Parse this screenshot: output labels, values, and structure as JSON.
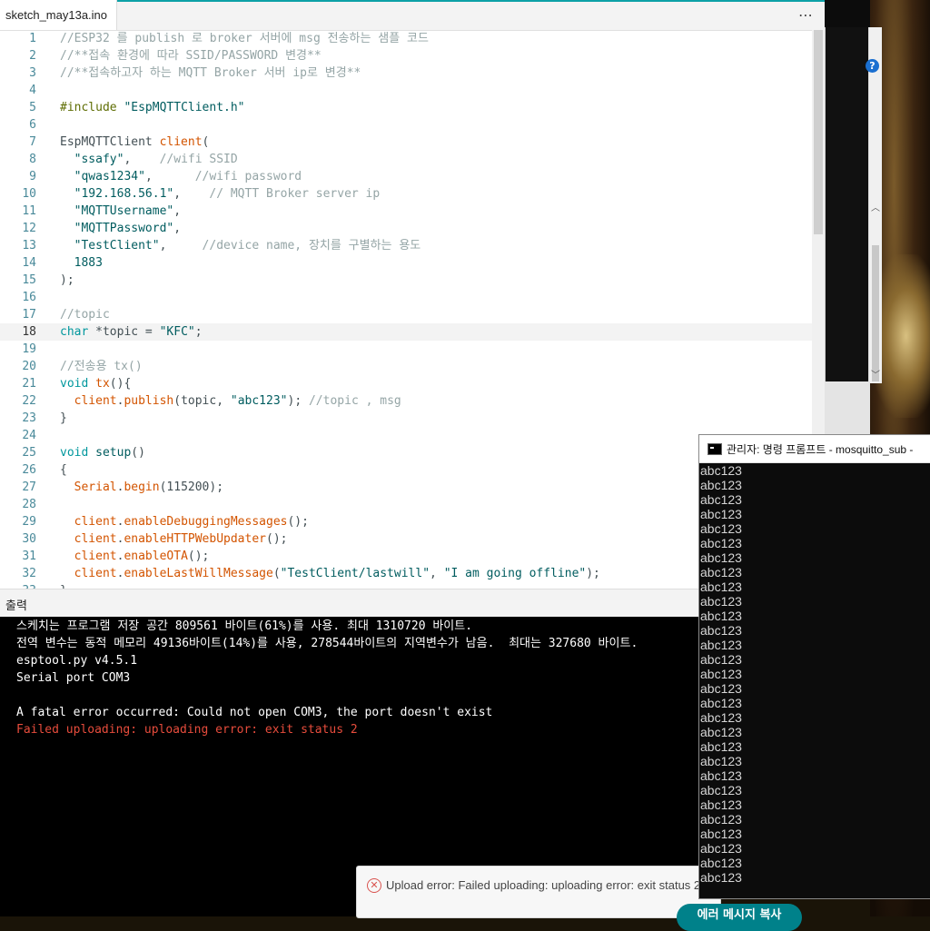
{
  "editor": {
    "tab_name": "sketch_may13a.ino",
    "more_menu": "⋯",
    "lines": [
      {
        "n": "1",
        "html": "<span class='c'>//ESP32 를 publish 로 broker 서버에 msg 전송하는 샘플 코드</span>"
      },
      {
        "n": "2",
        "html": "<span class='c'>//**접속 환경에 따라 SSID/PASSWORD 변경**</span>"
      },
      {
        "n": "3",
        "html": "<span class='c'>//**접속하고자 하는 MQTT Broker 서버 ip로 변경**</span>"
      },
      {
        "n": "4",
        "html": ""
      },
      {
        "n": "5",
        "html": "<span class='p'>#include</span> <span class='s'>\"EspMQTTClient.h\"</span>"
      },
      {
        "n": "6",
        "html": ""
      },
      {
        "n": "7",
        "html": "EspMQTTClient <span class='f'>client</span>("
      },
      {
        "n": "8",
        "html": "  <span class='s'>\"ssafy\"</span>,    <span class='c'>//wifi SSID</span>"
      },
      {
        "n": "9",
        "html": "  <span class='s'>\"qwas1234\"</span>,      <span class='c'>//wifi password</span>"
      },
      {
        "n": "10",
        "html": "  <span class='s'>\"192.168.56.1\"</span>,    <span class='c'>// MQTT Broker server ip</span>"
      },
      {
        "n": "11",
        "html": "  <span class='s'>\"MQTTUsername\"</span>,"
      },
      {
        "n": "12",
        "html": "  <span class='s'>\"MQTTPassword\"</span>,"
      },
      {
        "n": "13",
        "html": "  <span class='s'>\"TestClient\"</span>,     <span class='c'>//device name, 장치를 구별하는 용도</span>"
      },
      {
        "n": "14",
        "html": "  <span class='s'>1883</span>"
      },
      {
        "n": "15",
        "html": ");"
      },
      {
        "n": "16",
        "html": ""
      },
      {
        "n": "17",
        "html": "<span class='c'>//topic</span>"
      },
      {
        "n": "18",
        "html": "<span class='k'>char</span> *topic = <span class='s'>\"KFC\"</span>;",
        "active": true
      },
      {
        "n": "19",
        "html": ""
      },
      {
        "n": "20",
        "html": "<span class='c'>//전송용 tx()</span>"
      },
      {
        "n": "21",
        "html": "<span class='k'>void</span> <span class='f'>tx</span>(){"
      },
      {
        "n": "22",
        "html": "  <span class='f'>client</span>.<span class='f'>publish</span>(topic, <span class='s'>\"abc123\"</span>); <span class='c'>//topic , msg</span>"
      },
      {
        "n": "23",
        "html": "}"
      },
      {
        "n": "24",
        "html": ""
      },
      {
        "n": "25",
        "html": "<span class='k'>void</span> <span class='t'>setup</span>()"
      },
      {
        "n": "26",
        "html": "{"
      },
      {
        "n": "27",
        "html": "  <span class='f'>Serial</span>.<span class='f'>begin</span>(115200);"
      },
      {
        "n": "28",
        "html": ""
      },
      {
        "n": "29",
        "html": "  <span class='f'>client</span>.<span class='f'>enableDebuggingMessages</span>();"
      },
      {
        "n": "30",
        "html": "  <span class='f'>client</span>.<span class='f'>enableHTTPWebUpdater</span>();"
      },
      {
        "n": "31",
        "html": "  <span class='f'>client</span>.<span class='f'>enableOTA</span>();"
      },
      {
        "n": "32",
        "html": "  <span class='f'>client</span>.<span class='f'>enableLastWillMessage</span>(<span class='s'>\"TestClient/lastwill\"</span>, <span class='s'>\"I am going offline\"</span>);"
      },
      {
        "n": "33",
        "html": "}"
      }
    ]
  },
  "output": {
    "header": "출력",
    "lines": [
      {
        "text": "스케치는 프로그램 저장 공간 809561 바이트(61%)를 사용. 최대 1310720 바이트.",
        "error": false
      },
      {
        "text": "전역 변수는 동적 메모리 49136바이트(14%)를 사용, 278544바이트의 지역변수가 남음.  최대는 327680 바이트.",
        "error": false
      },
      {
        "text": "esptool.py v4.5.1",
        "error": false
      },
      {
        "text": "Serial port COM3",
        "error": false
      },
      {
        "text": "",
        "error": false
      },
      {
        "text": "A fatal error occurred: Could not open COM3, the port doesn't exist",
        "error": false
      },
      {
        "text": "Failed uploading: uploading error: exit status 2",
        "error": true
      }
    ]
  },
  "toast": {
    "message": "Upload error: Failed uploading: uploading error: exit status 2",
    "button_label": "에러 메시지 복사"
  },
  "cmd": {
    "title": "관리자: 명령 프롬프트 - mosquitto_sub  -",
    "lines": [
      "abc123",
      "abc123",
      "abc123",
      "abc123",
      "abc123",
      "abc123",
      "abc123",
      "abc123",
      "abc123",
      "abc123",
      "abc123",
      "abc123",
      "abc123",
      "abc123",
      "abc123",
      "abc123",
      "abc123",
      "abc123",
      "abc123",
      "abc123",
      "abc123",
      "abc123",
      "abc123",
      "abc123",
      "abc123",
      "abc123",
      "abc123",
      "abc123",
      "abc123"
    ]
  },
  "other_window": {
    "help_icon": "?"
  }
}
